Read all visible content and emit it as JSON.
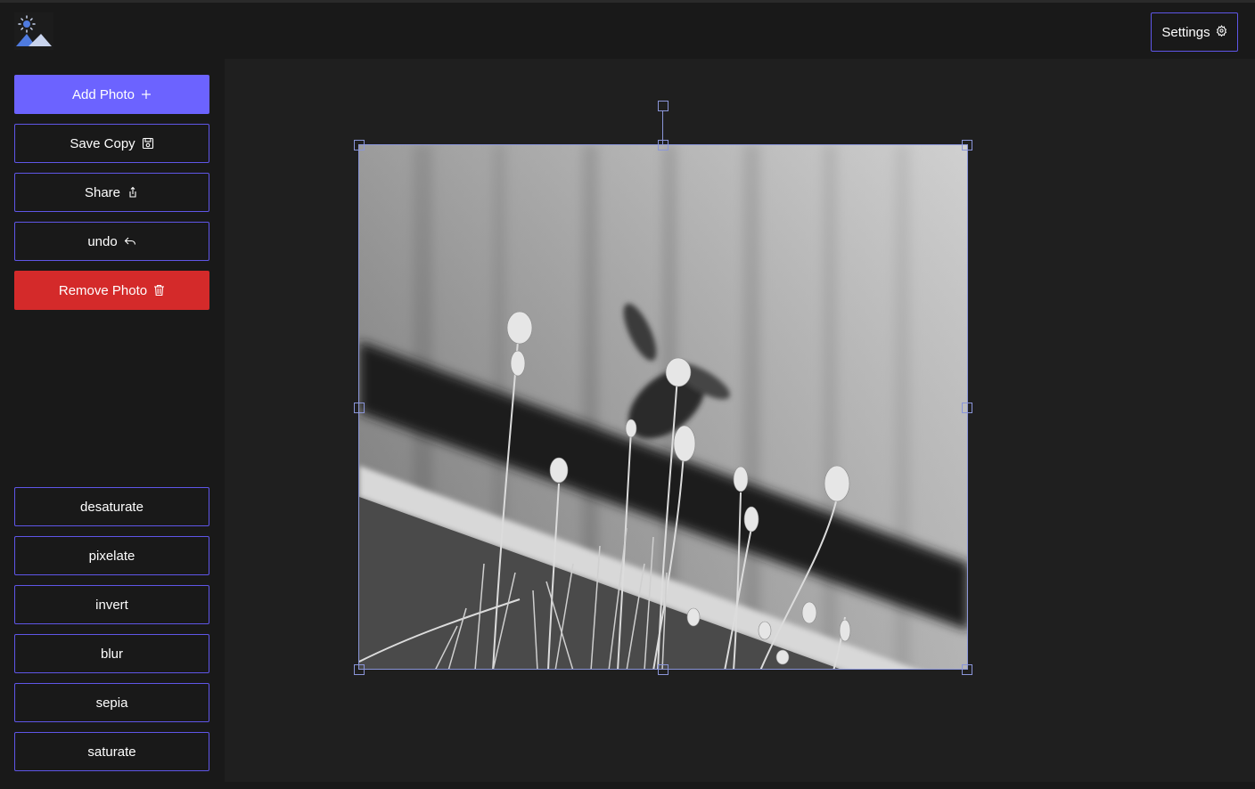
{
  "header": {
    "logo_icon": "image-editor-logo-icon",
    "settings_label": "Settings",
    "settings_icon": "gear-icon"
  },
  "sidebar": {
    "actions": [
      {
        "label": "Add Photo",
        "icon": "plus-icon"
      },
      {
        "label": "Save Copy",
        "icon": "floppy-disk-icon"
      },
      {
        "label": "Share",
        "icon": "share-icon"
      },
      {
        "label": "undo",
        "icon": "undo-icon"
      },
      {
        "label": "Remove Photo",
        "icon": "trash-icon"
      }
    ],
    "filters": [
      {
        "label": "desaturate"
      },
      {
        "label": "pixelate"
      },
      {
        "label": "invert"
      },
      {
        "label": "blur"
      },
      {
        "label": "sepia"
      },
      {
        "label": "saturate"
      }
    ]
  },
  "canvas": {
    "photo_subject": "grayscale photo of lavender flowers with hummingbird"
  },
  "colors": {
    "accent": "#6c63ff",
    "accent_border": "#5f56e8",
    "danger": "#d42a2a",
    "background": "#191919",
    "canvas_background": "#1f1f1f",
    "selection": "#8a95d9"
  }
}
